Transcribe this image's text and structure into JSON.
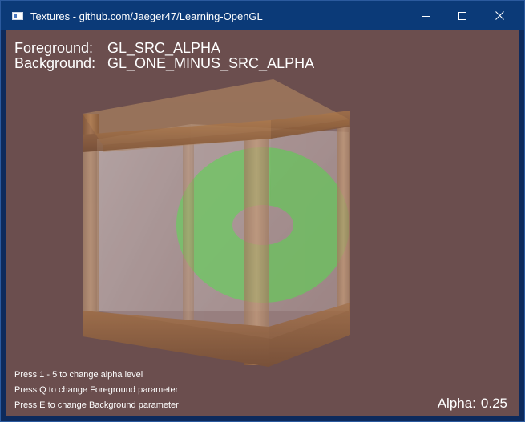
{
  "window": {
    "title": "Textures - github.com/Jaeger47/Learning-OpenGL",
    "icon": "app-window-icon",
    "controls": [
      "minimize-icon",
      "maximize-icon",
      "close-icon"
    ]
  },
  "hud": {
    "foreground_label": "Foreground:",
    "foreground_value": "GL_SRC_ALPHA",
    "background_label": "Background:",
    "background_value": "GL_ONE_MINUS_SRC_ALPHA"
  },
  "hints": [
    "Press 1 - 5 to change alpha level",
    "Press Q to change Foreground parameter",
    "Press E to change Background parameter"
  ],
  "alpha": {
    "label": "Alpha:",
    "value": "0.25"
  },
  "colors": {
    "clear_color": "#6b4e4e",
    "ring_color": "#4cbb3f",
    "wood_color": "#b07a4a",
    "title_bar": "#0b3a78"
  }
}
